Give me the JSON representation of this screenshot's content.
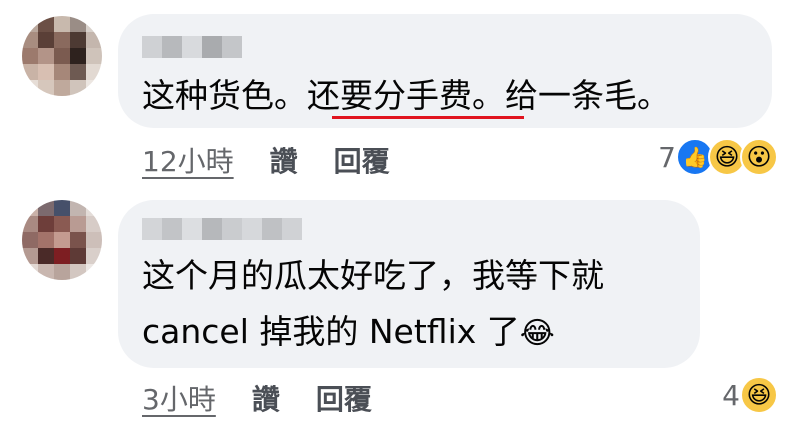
{
  "comments": [
    {
      "text_before": "这种货色。",
      "text_underlined": "还要分手费",
      "text_after": "。给一条毛。",
      "time": "12小時",
      "like_label": "讚",
      "reply_label": "回覆",
      "reaction_count": "7",
      "reactions": [
        "like-icon",
        "haha-icon",
        "wow-icon"
      ],
      "underline_color": "#e0141e"
    },
    {
      "line1": "这个月的瓜太好吃了，我等下就",
      "line2": "cancel 掉我的 Netflix 了",
      "inline_emoji": "😂",
      "time": "3小時",
      "like_label": "讚",
      "reply_label": "回覆",
      "reaction_count": "4",
      "reactions": [
        "haha-icon"
      ]
    }
  ],
  "colors": {
    "bubble": "#f0f2f5",
    "meta_text": "#65676b",
    "like_blue": "#1877f2"
  }
}
